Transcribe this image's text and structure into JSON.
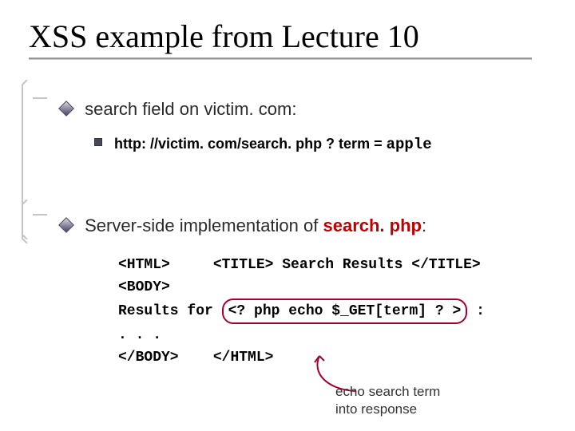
{
  "title": "XSS example from Lecture 10",
  "bullets": {
    "b1": "search field on victim. com:",
    "b1_url_a": "http: //victim. com/search. php ? term = ",
    "b1_url_b": "apple",
    "b2_a": "Server-side implementation of  ",
    "b2_b": "search. php",
    "b2_c": ":"
  },
  "code": {
    "l1a": "<HTML>",
    "l1b": "<TITLE> Search Results </TITLE>",
    "l2": "<BODY>",
    "l3a": "Results for ",
    "l3b": "<? php echo $_GET[term] ? >",
    "l3c": " :",
    "l4": ". . .",
    "l5a": "</BODY>",
    "l5b": "</HTML>"
  },
  "annotation": {
    "l1": "echo search term",
    "l2": "into response"
  }
}
